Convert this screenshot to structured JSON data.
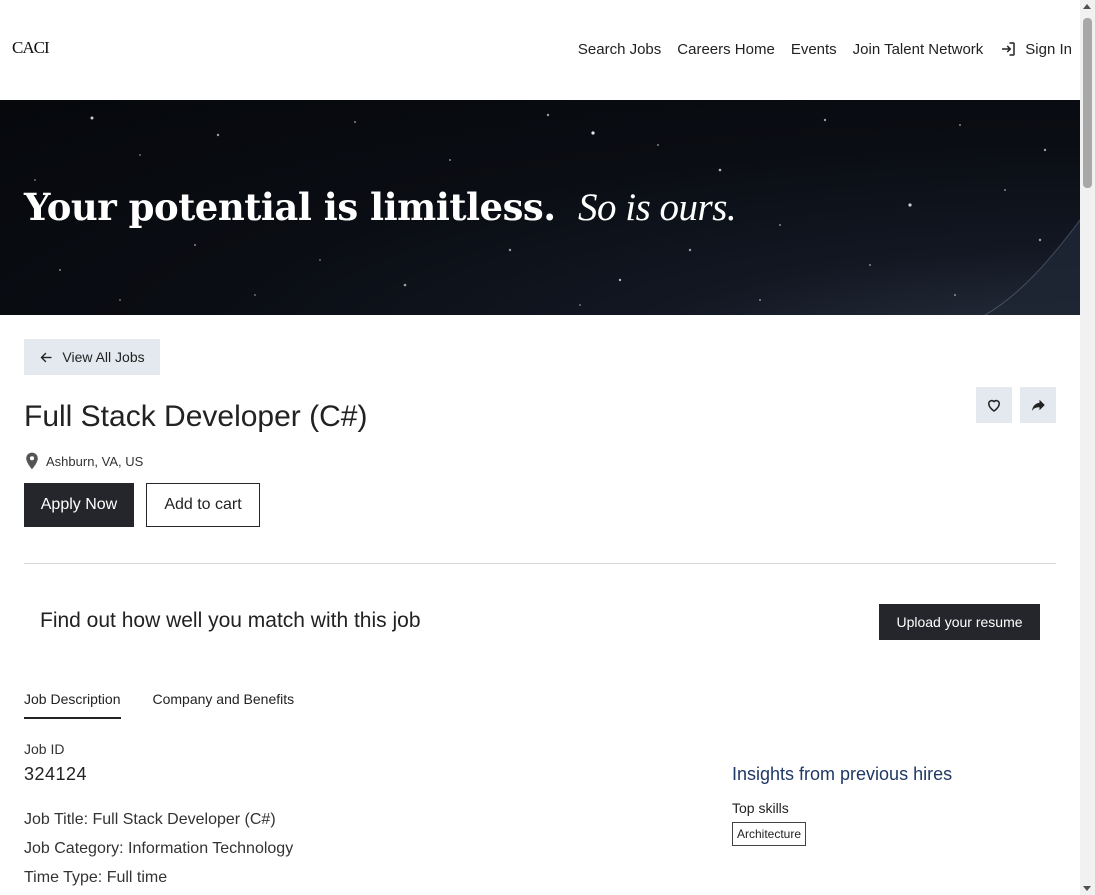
{
  "header": {
    "logo": "CACI",
    "nav": [
      {
        "label": "Search Jobs"
      },
      {
        "label": "Careers Home"
      },
      {
        "label": "Events"
      },
      {
        "label": "Join Talent Network"
      }
    ],
    "sign_in": "Sign In",
    "sign_in_icon": "sign-in-icon"
  },
  "hero": {
    "headline": "Your potential is limitless.",
    "tagline": "So is ours."
  },
  "job": {
    "back_label": "View All Jobs",
    "title": "Full Stack Developer (C#)",
    "location": "Ashburn, VA, US",
    "apply_label": "Apply Now",
    "cart_label": "Add to cart",
    "favorite_icon": "heart-icon",
    "share_icon": "share-icon"
  },
  "match": {
    "text": "Find out how well you match with this job",
    "upload_label": "Upload your resume"
  },
  "tabs": [
    {
      "label": "Job Description",
      "active": true
    },
    {
      "label": "Company and Benefits",
      "active": false
    }
  ],
  "details": {
    "job_id_label": "Job ID",
    "job_id": "324124",
    "lines": [
      "Job Title: Full Stack Developer (C#)",
      "Job Category: Information Technology",
      "Time Type: Full time"
    ]
  },
  "insights": {
    "title": "Insights from previous hires",
    "top_skills_label": "Top skills",
    "skills": [
      "Architecture"
    ]
  },
  "colors": {
    "primary_button": "#25262b",
    "secondary_bg": "#e3e9ef",
    "insights_title": "#1f3864"
  }
}
